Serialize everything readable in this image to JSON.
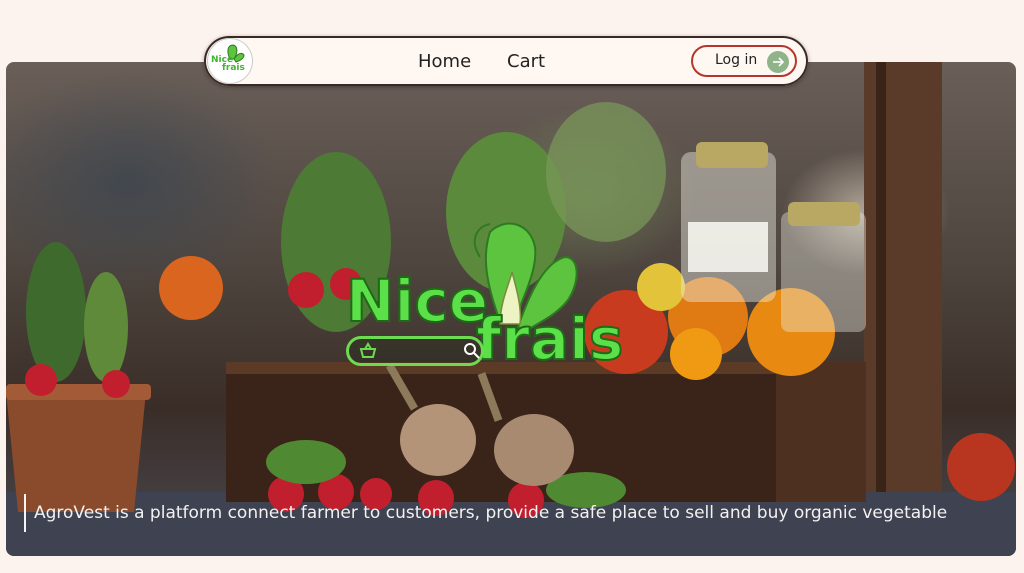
{
  "nav": {
    "logo_text_top": "Nice",
    "logo_text_bottom": "frais",
    "links": [
      {
        "label": "Home"
      },
      {
        "label": "Cart"
      }
    ],
    "login_label": "Log in"
  },
  "hero": {
    "brand_line1": "Nice",
    "brand_line2": "frais",
    "tagline": "AgroVest is a platform connect farmer to customers, provide a safe place to sell and buy organic vegetable"
  },
  "colors": {
    "brand_green": "#5be04a",
    "login_border": "#b4362d",
    "arrow_bg": "#8fb48a",
    "background": "#fdf3ee"
  },
  "icons": [
    "bok-choy-logo-icon",
    "arrow-right-icon",
    "basket-icon",
    "search-icon"
  ]
}
